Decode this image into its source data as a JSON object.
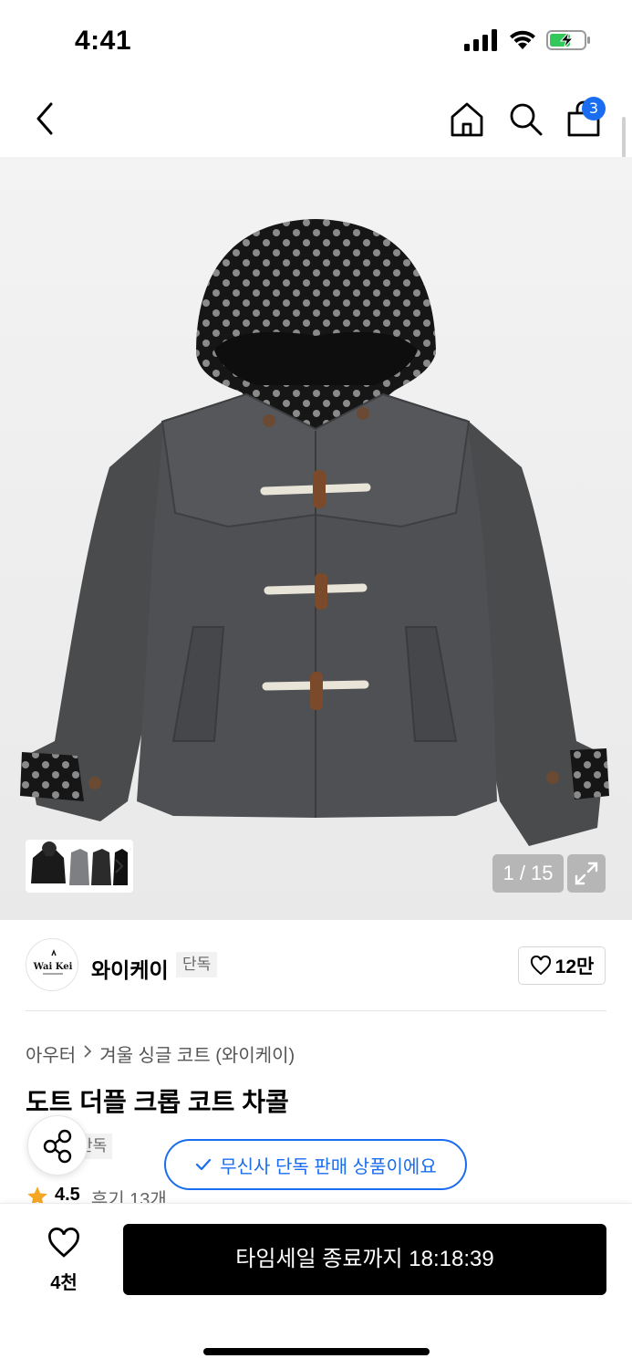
{
  "status_bar": {
    "time": "4:41"
  },
  "nav": {
    "cart_badge": "3"
  },
  "gallery": {
    "page_indicator": "1 / 15"
  },
  "brand": {
    "name": "와이케이",
    "tag": "단독",
    "logo_text": "Wai Kei",
    "likes": "12만"
  },
  "breadcrumb": {
    "items": [
      "아우터",
      "겨울 싱글 코트 (와이케이)"
    ]
  },
  "product": {
    "title": "도트 더플 크롭 코트 차콜",
    "tag": "단독",
    "exclusive_notice": "무신사 단독 판매 상품이에요",
    "rating": "4.5",
    "reviews": "후기 13개"
  },
  "bottom": {
    "wish_count": "4천",
    "buy_label": "타임세일 종료까지 18:18:39"
  },
  "colors": {
    "accent": "#1a6cf0",
    "star": "#f5a623",
    "coat": "#4a4b4d",
    "lining": "#1b1b1b"
  }
}
